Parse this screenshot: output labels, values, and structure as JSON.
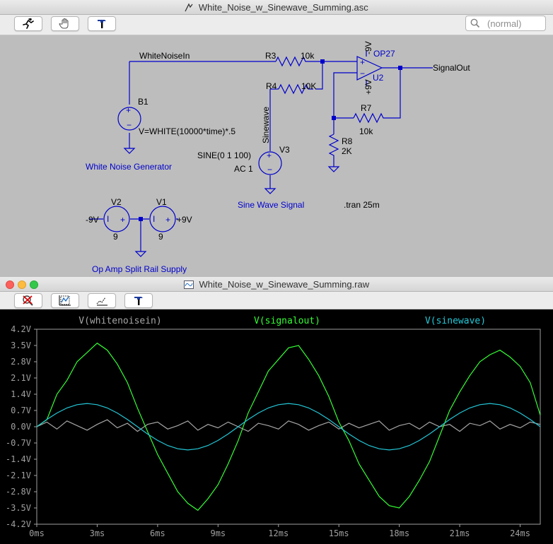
{
  "schematic_window": {
    "title": "White_Noise_w_Sinewave_Summing.asc",
    "search_placeholder": "(normal)",
    "tool_icons": [
      "wire-run-icon",
      "hand-pan-icon",
      "hammer-icon"
    ]
  },
  "schematic": {
    "nets": {
      "white_noise": "WhiteNoiseIn",
      "sinewave": "Sinewave",
      "signal_out": "SignalOut"
    },
    "r3": {
      "name": "R3",
      "value": "10k"
    },
    "r4": {
      "name": "R4",
      "value": "10K"
    },
    "r7": {
      "name": "R7",
      "value": "10k"
    },
    "r8": {
      "name": "R8",
      "value": "2K"
    },
    "b1": {
      "name": "B1",
      "expr": "V=WHITE(10000*time)*.5"
    },
    "v3": {
      "name": "V3",
      "value1": "SINE(0 1 100)",
      "value2": "AC 1"
    },
    "v1": {
      "name": "V1",
      "value": "9"
    },
    "v2": {
      "name": "V2",
      "value": "9"
    },
    "opamp": {
      "model": "OP27",
      "ref": "U2",
      "neg_supply": "-9V",
      "pos_supply": "+9V"
    },
    "rail_labels": {
      "neg": "-9V",
      "pos": "+9V"
    },
    "comments": {
      "noise_gen": "White Noise Generator",
      "sine_signal": "Sine Wave Signal",
      "split_supply": "Op Amp Split Rail Supply",
      "tran": ".tran 25m"
    }
  },
  "plot_window": {
    "title": "White_Noise_w_Sinewave_Summing.raw",
    "tool_icons": [
      "zoom-cancel-icon",
      "autorange-icon",
      "pan-trace-icon",
      "hammer-icon"
    ]
  },
  "chart_data": {
    "type": "line",
    "title": "",
    "x_unit": "ms",
    "y_unit": "V",
    "xlim": [
      0,
      25
    ],
    "ylim": [
      -4.2,
      4.2
    ],
    "x_ticks": [
      "0ms",
      "3ms",
      "6ms",
      "9ms",
      "12ms",
      "15ms",
      "18ms",
      "21ms",
      "24ms"
    ],
    "y_ticks": [
      "4.2V",
      "3.5V",
      "2.8V",
      "2.1V",
      "1.4V",
      "0.7V",
      "0.0V",
      "-0.7V",
      "-1.4V",
      "-2.1V",
      "-2.8V",
      "-3.5V",
      "-4.2V"
    ],
    "grid": false,
    "legend_position": "top",
    "colors": {
      "whitenoisein": "#a6a6a6",
      "signalout": "#33ff33",
      "sinewave": "#22c8d8"
    },
    "series": [
      {
        "name": "V(whitenoisein)",
        "x": [
          0,
          0.5,
          1,
          1.5,
          2,
          2.5,
          3,
          3.5,
          4,
          4.5,
          5,
          5.5,
          6,
          6.5,
          7,
          7.5,
          8,
          8.5,
          9,
          9.5,
          10,
          10.5,
          11,
          11.5,
          12,
          12.5,
          13,
          13.5,
          14,
          14.5,
          15,
          15.5,
          16,
          16.5,
          17,
          17.5,
          18,
          18.5,
          19,
          19.5,
          20,
          20.5,
          21,
          21.5,
          22,
          22.5,
          23,
          23.5,
          24,
          24.5,
          25
        ],
        "y": [
          0,
          0.2,
          -0.1,
          0.25,
          0.05,
          -0.15,
          0.1,
          0.3,
          -0.05,
          0.15,
          -0.2,
          0.1,
          0.2,
          -0.1,
          0.05,
          0.25,
          -0.15,
          0.1,
          -0.05,
          0.2,
          0.0,
          -0.2,
          0.15,
          0.05,
          -0.1,
          0.25,
          0.1,
          -0.15,
          0.05,
          0.2,
          -0.1,
          0.15,
          -0.05,
          0.1,
          0.25,
          -0.15,
          0.05,
          0.15,
          -0.1,
          0.2,
          0.0,
          0.1,
          -0.2,
          0.15,
          0.05,
          0.25,
          -0.1,
          0.1,
          -0.05,
          0.2,
          0.1
        ]
      },
      {
        "name": "V(signalout)",
        "x": [
          0,
          0.5,
          1,
          1.5,
          2,
          2.5,
          3,
          3.5,
          4,
          4.5,
          5,
          5.5,
          6,
          6.5,
          7,
          7.5,
          8,
          8.5,
          9,
          9.5,
          10,
          10.5,
          11,
          11.5,
          12,
          12.5,
          13,
          13.5,
          14,
          14.5,
          15,
          15.5,
          16,
          16.5,
          17,
          17.5,
          18,
          18.5,
          19,
          19.5,
          20,
          20.5,
          21,
          21.5,
          22,
          22.5,
          23,
          23.5,
          24,
          24.5,
          25
        ],
        "y": [
          0,
          0.3,
          1.4,
          2.0,
          2.8,
          3.2,
          3.6,
          3.3,
          2.7,
          1.9,
          0.8,
          -0.2,
          -1.2,
          -2.0,
          -2.8,
          -3.3,
          -3.6,
          -3.1,
          -2.5,
          -1.6,
          -0.6,
          0.6,
          1.5,
          2.4,
          2.9,
          3.4,
          3.5,
          2.9,
          2.2,
          1.3,
          0.2,
          -0.6,
          -1.6,
          -2.3,
          -3.0,
          -3.4,
          -3.5,
          -3.0,
          -2.3,
          -1.5,
          -0.4,
          0.7,
          1.5,
          2.2,
          2.8,
          3.1,
          3.3,
          3.0,
          2.6,
          1.9,
          0.5
        ]
      },
      {
        "name": "V(sinewave)",
        "x": [
          0,
          0.5,
          1,
          1.5,
          2,
          2.5,
          3,
          3.5,
          4,
          4.5,
          5,
          5.5,
          6,
          6.5,
          7,
          7.5,
          8,
          8.5,
          9,
          9.5,
          10,
          10.5,
          11,
          11.5,
          12,
          12.5,
          13,
          13.5,
          14,
          14.5,
          15,
          15.5,
          16,
          16.5,
          17,
          17.5,
          18,
          18.5,
          19,
          19.5,
          20,
          20.5,
          21,
          21.5,
          22,
          22.5,
          23,
          23.5,
          24,
          24.5,
          25
        ],
        "y": [
          0,
          0.31,
          0.59,
          0.81,
          0.95,
          1.0,
          0.95,
          0.81,
          0.59,
          0.31,
          0,
          -0.31,
          -0.59,
          -0.81,
          -0.95,
          -1.0,
          -0.95,
          -0.81,
          -0.59,
          -0.31,
          0,
          0.31,
          0.59,
          0.81,
          0.95,
          1.0,
          0.95,
          0.81,
          0.59,
          0.31,
          0,
          -0.31,
          -0.59,
          -0.81,
          -0.95,
          -1.0,
          -0.95,
          -0.81,
          -0.59,
          -0.31,
          0,
          0.31,
          0.59,
          0.81,
          0.95,
          1.0,
          0.95,
          0.81,
          0.59,
          0.31,
          0
        ]
      }
    ]
  }
}
